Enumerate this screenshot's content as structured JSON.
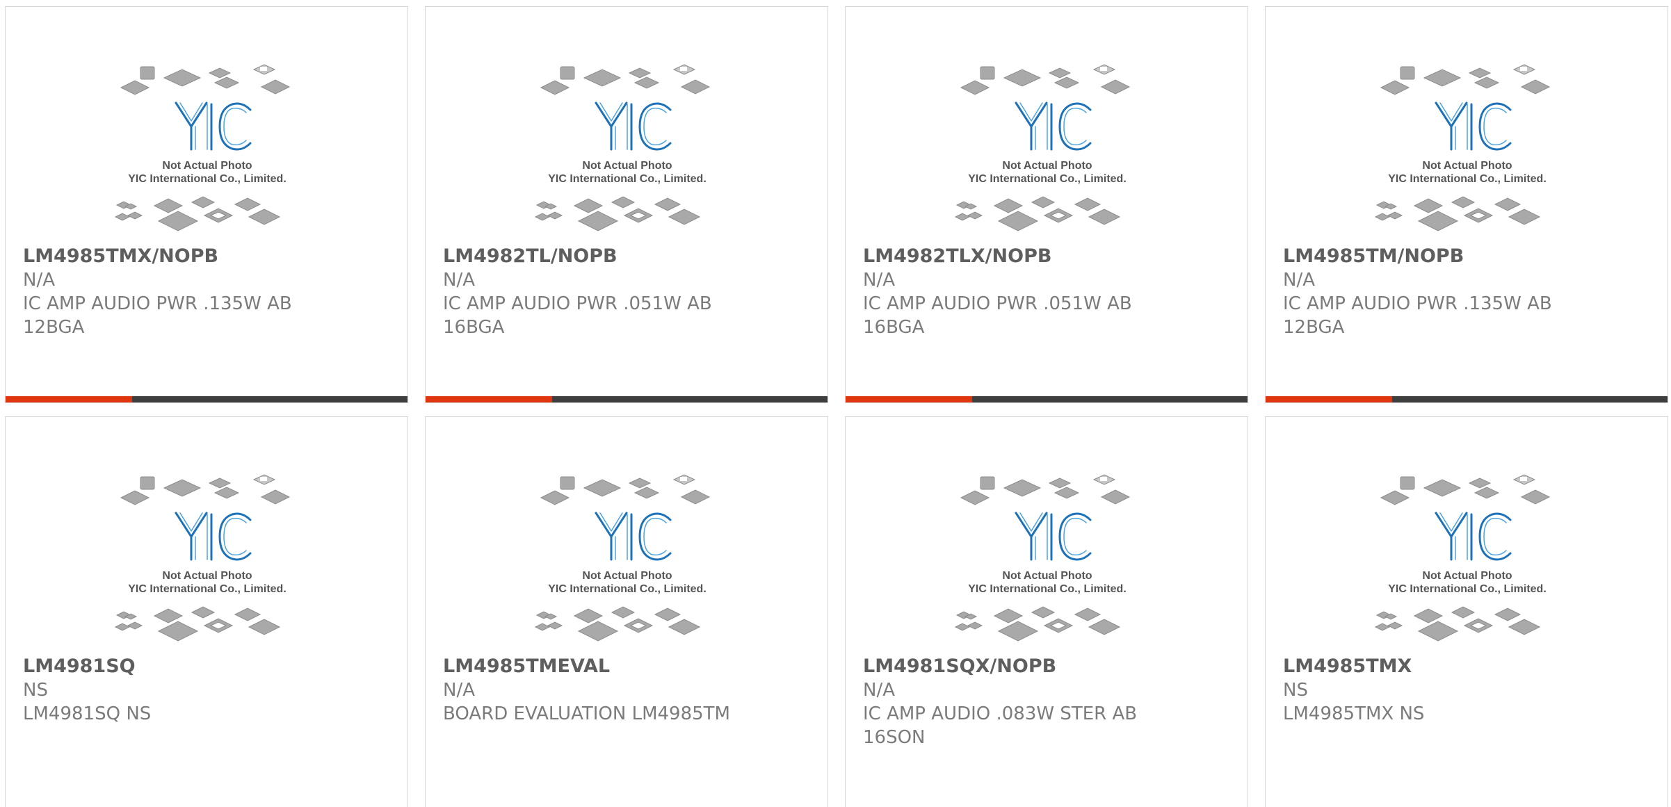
{
  "placeholder": {
    "caption_line1": "Not Actual Photo",
    "caption_line2": "YIC International Co., Limited.",
    "logo_text": "YIC",
    "logo_color": "#1d72b8"
  },
  "colors": {
    "accent": "#e0360f",
    "bar": "#3e3e3e",
    "border": "#d6d6d6",
    "title": "#5e5e5e",
    "text": "#7b7b7b"
  },
  "products": [
    {
      "part": "LM4985TMX/NOPB",
      "mfr": "N/A",
      "desc": "IC AMP AUDIO PWR .135W AB 12BGA"
    },
    {
      "part": "LM4982TL/NOPB",
      "mfr": "N/A",
      "desc": "IC AMP AUDIO PWR .051W AB 16BGA"
    },
    {
      "part": "LM4982TLX/NOPB",
      "mfr": "N/A",
      "desc": "IC AMP AUDIO PWR .051W AB 16BGA"
    },
    {
      "part": "LM4985TM/NOPB",
      "mfr": "N/A",
      "desc": "IC AMP AUDIO PWR .135W AB 12BGA"
    },
    {
      "part": "LM4981SQ",
      "mfr": "NS",
      "desc": "LM4981SQ NS"
    },
    {
      "part": "LM4985TMEVAL",
      "mfr": "N/A",
      "desc": "BOARD EVALUATION LM4985TM"
    },
    {
      "part": "LM4981SQX/NOPB",
      "mfr": "N/A",
      "desc": "IC AMP AUDIO .083W STER AB 16SON"
    },
    {
      "part": "LM4985TMX",
      "mfr": "NS",
      "desc": "LM4985TMX NS"
    }
  ]
}
